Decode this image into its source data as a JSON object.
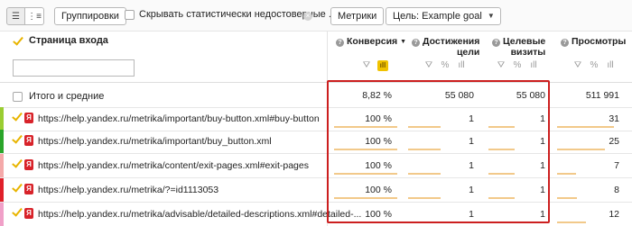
{
  "toolbar": {
    "view_list_icon": "list-icon",
    "view_tree_icon": "tree-icon",
    "group_label": "Группировки",
    "hide_unreliable_label": "Скрывать статистически недостоверные ...",
    "clear_icon": "×",
    "metrics_label": "Метрики",
    "goal_label": "Цель: Example goal"
  },
  "header": {
    "dimension_title": "Страница входа",
    "filter_placeholder": "",
    "metrics": {
      "conversion": {
        "label": "Конверсия",
        "sort_arrow": "▼"
      },
      "achievements": {
        "line1": "Достижения",
        "line2": "цели"
      },
      "goal_visits": {
        "line1": "Целевые",
        "line2": "визиты"
      },
      "pageviews": {
        "label": "Просмотры"
      }
    },
    "ctrl_filter": "⛛",
    "ctrl_percent": "%",
    "ctrl_chart": "ıll"
  },
  "totals": {
    "label": "Итого и средние",
    "conversion": "8,82 %",
    "achievements": "55 080",
    "goal_visits": "55 080",
    "pageviews": "511 991"
  },
  "rows": [
    {
      "color": "#9acd32",
      "url": "https://help.yandex.ru/metrika/important/buy-button.xml#buy-button",
      "conversion": "100 %",
      "achievements": "1",
      "goal_visits": "1",
      "pageviews": "31",
      "bars": {
        "conversion": 1.0,
        "achievements": 0.5,
        "goal_visits": 0.5,
        "pageviews": 0.9
      }
    },
    {
      "color": "#2aa52a",
      "url": "https://help.yandex.ru/metrika/important/buy_button.xml",
      "conversion": "100 %",
      "achievements": "1",
      "goal_visits": "1",
      "pageviews": "25",
      "bars": {
        "conversion": 1.0,
        "achievements": 0.5,
        "goal_visits": 0.5,
        "pageviews": 0.75
      }
    },
    {
      "color": "#f4a9a9",
      "url": "https://help.yandex.ru/metrika/content/exit-pages.xml#exit-pages",
      "conversion": "100 %",
      "achievements": "1",
      "goal_visits": "1",
      "pageviews": "7",
      "bars": {
        "conversion": 1.0,
        "achievements": 0.5,
        "goal_visits": 0.5,
        "pageviews": 0.3
      }
    },
    {
      "color": "#e0202a",
      "url": "https://help.yandex.ru/metrika/?=id1113053",
      "conversion": "100 %",
      "achievements": "1",
      "goal_visits": "1",
      "pageviews": "8",
      "bars": {
        "conversion": 1.0,
        "achievements": 0.5,
        "goal_visits": 0.5,
        "pageviews": 0.32
      }
    },
    {
      "color": "#f0a0c8",
      "url": "https://help.yandex.ru/metrika/advisable/detailed-descriptions.xml#detailed-...",
      "conversion": "100 %",
      "achievements": "1",
      "goal_visits": "1",
      "pageviews": "12",
      "bars": {
        "conversion": 1.0,
        "achievements": 0.5,
        "goal_visits": 0.5,
        "pageviews": 0.45
      }
    }
  ],
  "colors": {
    "highlight": "#cc1f1f",
    "accent_yellow": "#f0c200",
    "bar": "#f2c98a"
  }
}
